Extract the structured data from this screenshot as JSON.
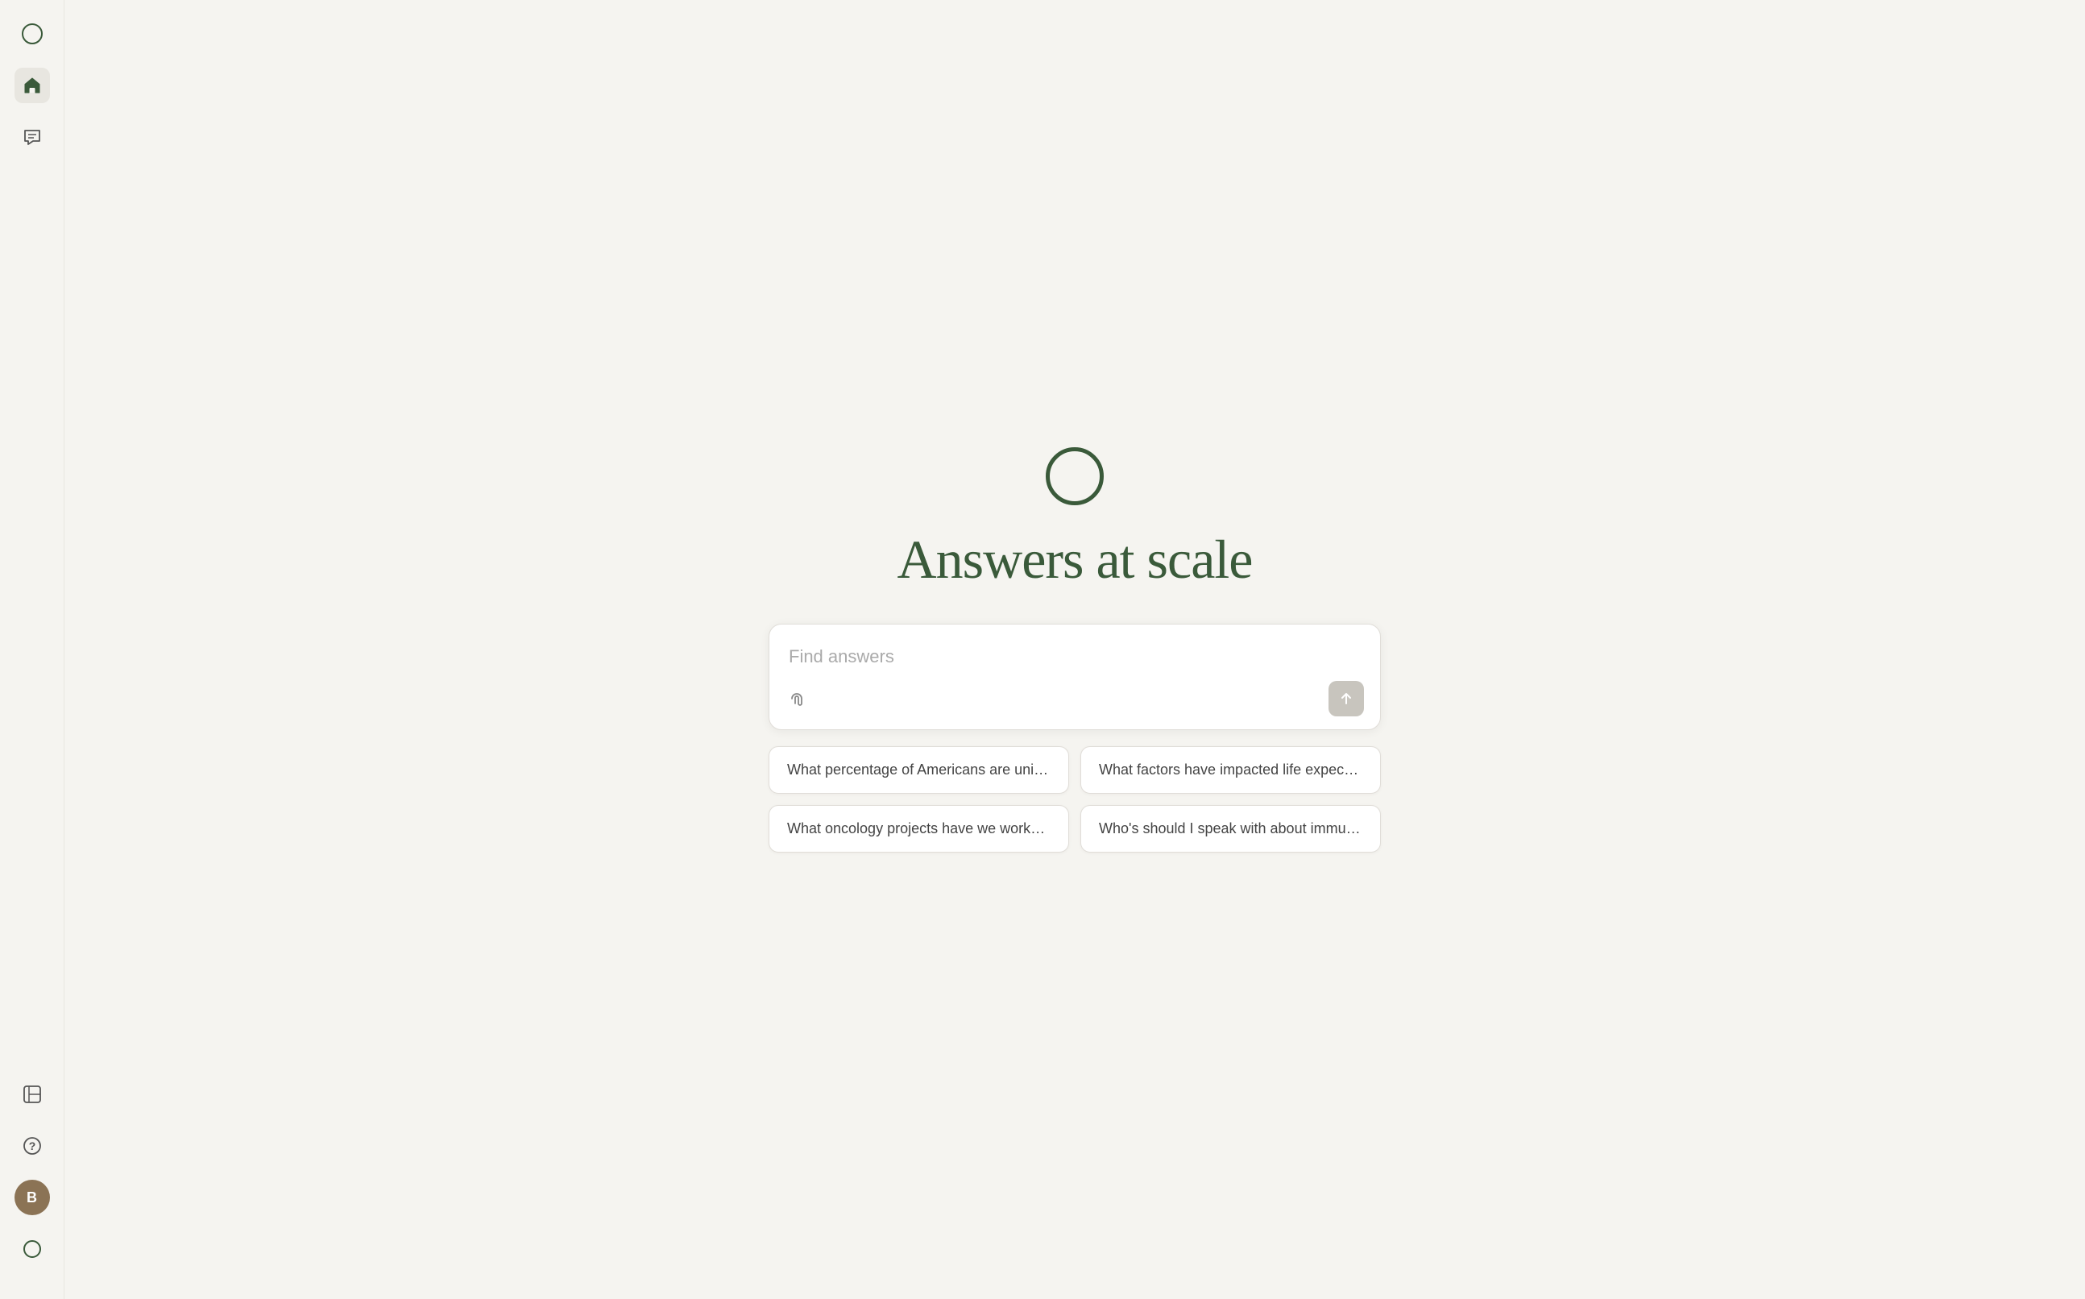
{
  "sidebar": {
    "top_icons": [
      {
        "name": "logo-circle-icon",
        "type": "circle-outline"
      },
      {
        "name": "home-icon",
        "type": "home",
        "active": true
      },
      {
        "name": "chat-icon",
        "type": "chat"
      }
    ],
    "bottom_icons": [
      {
        "name": "panel-icon",
        "type": "panel"
      },
      {
        "name": "help-icon",
        "type": "help"
      },
      {
        "name": "avatar",
        "label": "B"
      },
      {
        "name": "status-circle-icon",
        "type": "small-circle"
      }
    ]
  },
  "main": {
    "headline": "Answers at scale",
    "search": {
      "placeholder": "Find answers",
      "value": ""
    },
    "suggestions": [
      {
        "id": "s1",
        "text": "What percentage of Americans are uninsu..."
      },
      {
        "id": "s2",
        "text": "What factors have impacted life expectanc..."
      },
      {
        "id": "s3",
        "text": "What oncology projects have we worked o..."
      },
      {
        "id": "s4",
        "text": "Who's should I speak with about immunot..."
      }
    ]
  },
  "icons": {
    "send_arrow": "↑",
    "attach": "🖇"
  }
}
